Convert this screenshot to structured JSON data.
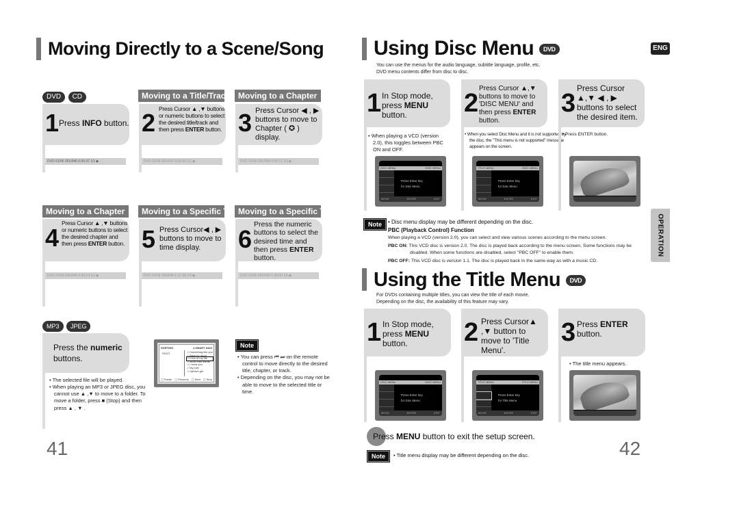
{
  "left_page": {
    "title": "Moving Directly to a Scene/Song",
    "badges": [
      "DVD",
      "CD"
    ],
    "sections_row1": [
      "Moving to a Title/Track",
      "Moving to a Chapter"
    ],
    "sections_row2": [
      "Moving to a Chapter",
      "Moving to a Specific Time",
      "Moving to a Specific Time"
    ],
    "steps": [
      {
        "num": "1",
        "parts": [
          "Press ",
          "INFO",
          " button."
        ]
      },
      {
        "num": "2",
        "parts": [
          "Press Cursor ▲ ,▼  buttons or numeric buttons to select the desired title/track and then press ",
          "ENTER",
          " button."
        ]
      },
      {
        "num": "3",
        "parts": [
          "Press Cursor ◀ , ▶ buttons to move to Chapter ( ✪ ) display.",
          "",
          ""
        ]
      },
      {
        "num": "4",
        "parts": [
          "Press Cursor ▲ ,▼ buttons or numeric buttons to select the desired chapter and then press ",
          "ENTER",
          " button."
        ]
      },
      {
        "num": "5",
        "parts": [
          "Press Cursor◀ , ▶ buttons to move to time display.",
          "",
          ""
        ]
      },
      {
        "num": "6",
        "parts": [
          "Press the numeric buttons to select the desired time and then press ",
          "ENTER",
          " button."
        ]
      }
    ],
    "status_bars": [
      "DVD  01/05   001/040   0:00:37   1/1 ▶",
      "DVD  03/05   001/032   0:00:00   1/1 ▶",
      "DVD  01/05   001/040   0:00:11   1/1 ▶",
      "DVD  01/05   026/040   0:00:14   1/1 ▶",
      "DVD  01/05   025/040   1:17:38   1/1 ▶",
      "DVD  01/05   026/040   1:30:00   1/1 ▶"
    ],
    "mp3_badges": [
      "MP3",
      "JPEG"
    ],
    "mp3_step": {
      "parts": [
        "Press the ",
        "numeric",
        " buttons."
      ]
    },
    "mp3_bullets": [
      "The selected file will be played.",
      "When playing an MP3 or JPEG disc, you cannot use ▲ ,▼  to move to a folder. To move a folder, press ■ (Stop) and then press ▲ , ▼ ."
    ],
    "mp3_screen": {
      "header": "SORTING",
      "mode": "4 SMART NAVI",
      "folder": "ROOT",
      "tracks": [
        "Something like you",
        "Back for good",
        "Love of my life",
        "More than words",
        "I need you",
        "My love",
        "Uptown girl"
      ],
      "selected_track": "Love of my life",
      "footer": [
        "Pause",
        "Previous",
        "Next",
        "Stop"
      ]
    },
    "note_label": "Note",
    "note_bullets": [
      "You can press ⏮ ⏭  on the remote control to move directly to the desired title, chapter, or track.",
      "Depending on the disc, you may not be able to move to the selected title or time."
    ],
    "page_number": "41"
  },
  "right_page": {
    "lang_tab": "ENG",
    "side_tab": "OPERATION",
    "disc_menu": {
      "title": "Using Disc Menu",
      "badge": "DVD",
      "intro": [
        "You can use the menus for the audio language, subtitle language, profile, etc.",
        "DVD menu contents differ from disc to disc."
      ],
      "steps": [
        {
          "num": "1",
          "parts": [
            "In Stop mode, press ",
            "MENU",
            " button."
          ],
          "bullet": "When playing a VCD (version 2.0), this toggles between PBC ON and OFF."
        },
        {
          "num": "2",
          "parts": [
            "Press Cursor  ▲,▼ buttons to move to 'DISC MENU' and then press ",
            "ENTER",
            " button."
          ],
          "bullet": "When you select Disc Menu and it is not supported by the disc, the \"This menu is not supported\" message appears on the screen."
        },
        {
          "num": "3",
          "parts": [
            "Press Cursor ▲,▼ ◀ , ▶  buttons to select the desired item.",
            "",
            ""
          ],
          "bullet": "Press ENTER button."
        }
      ],
      "screens": [
        {
          "header_left": "DISC MENU",
          "header_right": "DISC MENU",
          "msg": [
            "Press Enter key",
            "for Disc Menu"
          ],
          "footer": [
            "MOVE",
            "ENTER",
            "EXIT"
          ]
        },
        {
          "header_left": "TITLE MENU",
          "header_right": "DISC MENU",
          "msg": [
            "Press Enter key",
            "for Disc Menu"
          ],
          "footer": [
            "MOVE",
            "ENTER",
            "EXIT"
          ]
        }
      ],
      "note_label": "Note",
      "note_text": "Disc menu display may be different depending on the disc.",
      "pbc_title": "PBC (Playback Control) Function",
      "pbc_desc": "When playing a VCD (version 2.0), you can select and view various scenes according to the menu screen.",
      "pbc_on_label": "PBC ON:",
      "pbc_on_text": "This VCD disc is version 2.0. The disc is played back according to the menu screen. Some functions may be disabled. When some functions are disabled, select \"PBC OFF\" to enable them.",
      "pbc_off_label": "PBC OFF:",
      "pbc_off_text": "This VCD disc is version 1.1. The disc is played back in the same way as with a music CD."
    },
    "title_menu": {
      "title": "Using the Title Menu",
      "badge": "DVD",
      "intro": [
        "For DVDs containing multiple titles, you can view the title of each movie.",
        "Depending on the disc, the availability of this feature may vary."
      ],
      "steps": [
        {
          "num": "1",
          "parts": [
            "In Stop mode, press ",
            "MENU",
            " button."
          ]
        },
        {
          "num": "2",
          "parts": [
            "Press Cursor▲ ,▼ button to move to 'Title Menu'.",
            "",
            ""
          ]
        },
        {
          "num": "3",
          "parts": [
            "Press ",
            "ENTER",
            " button."
          ]
        }
      ],
      "step3_bullet": "The title menu appears.",
      "screens": [
        {
          "header_left": "DISC MENU",
          "header_right": "DISC MENU",
          "msg": [
            "Press Enter key",
            "for Disc Menu"
          ],
          "footer": [
            "MOVE",
            "ENTER",
            "EXIT"
          ]
        },
        {
          "header_left": "TITLE MENU",
          "header_right": "TITLE MENU",
          "msg": [
            "Press Enter key",
            "for Title Menu"
          ],
          "footer": [
            "MOVE",
            "ENTER",
            "EXIT"
          ]
        }
      ],
      "exit_parts": [
        "Press ",
        "MENU",
        " button to exit the setup screen."
      ],
      "note_label": "Note",
      "note_text": "Title menu display may be different depending on the disc."
    },
    "page_number": "42"
  }
}
